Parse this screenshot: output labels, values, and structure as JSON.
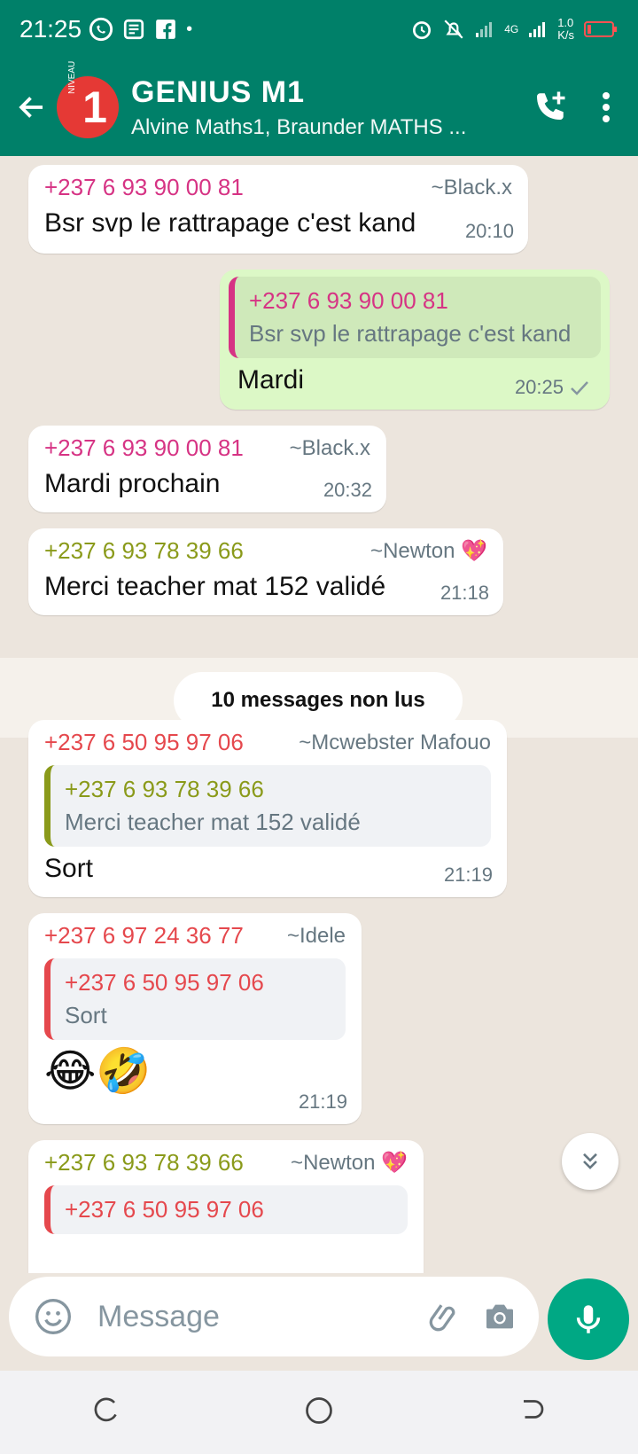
{
  "status": {
    "time": "21:25",
    "network": "4G",
    "speed_value": "1.0",
    "speed_unit": "K/s"
  },
  "header": {
    "avatar_badge": "NIVEAU",
    "avatar_number": "1",
    "title": "GENIUS  M1",
    "subtitle": "Alvine Maths1, Braunder MATHS ..."
  },
  "colors": {
    "header": "#008069",
    "pink": "#d63384",
    "olive": "#8a9a1a",
    "red": "#e5484d",
    "outgoing": "#dcf8c6",
    "tick": "#8696a0"
  },
  "messages": [
    {
      "sender": "+237 6 93 90 00 81",
      "alias": "~Black.x",
      "text": "Bsr svp le rattrapage c'est kand",
      "time": "20:10"
    },
    {
      "quote_sender": "+237 6 93 90 00 81",
      "quote_text": "Bsr svp le rattrapage c'est kand",
      "text": "Mardi",
      "time": "20:25"
    },
    {
      "sender": "+237 6 93 90 00 81",
      "alias": "~Black.x",
      "text": "Mardi prochain",
      "time": "20:32"
    },
    {
      "sender": "+237 6 93 78 39 66",
      "alias": "~Newton 💖",
      "text": "Merci teacher mat 152 validé",
      "time": "21:18"
    },
    {
      "sender": "+237 6 50 95 97 06",
      "alias": "~Mcwebster Mafouo",
      "quote_sender": "+237 6 93 78 39 66",
      "quote_text": "Merci teacher mat 152 validé",
      "text": "Sort",
      "time": "21:19"
    },
    {
      "sender": "+237 6 97 24 36 77",
      "alias": "~Idele",
      "quote_sender": "+237 6 50 95 97 06",
      "quote_text": "Sort",
      "text": "😂🤣",
      "time": "21:19"
    },
    {
      "sender": "+237 6 93 78 39 66",
      "alias": "~Newton 💖",
      "quote_sender": "+237 6 50 95 97 06"
    }
  ],
  "unread_label": "10 messages non lus",
  "input": {
    "placeholder": "Message"
  }
}
